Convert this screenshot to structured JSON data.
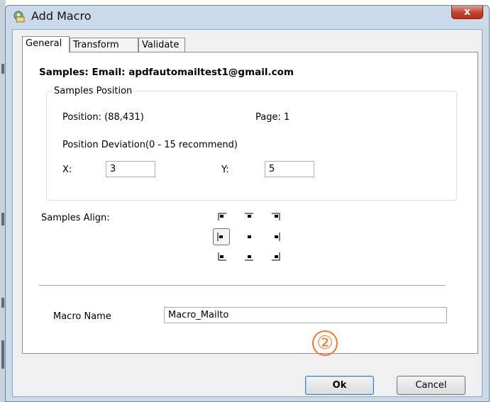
{
  "window": {
    "title": "Add Macro",
    "close_glyph": "x"
  },
  "tabs": [
    {
      "label": "General",
      "active": true
    },
    {
      "label": "Transform",
      "active": false
    },
    {
      "label": "Validate",
      "active": false
    }
  ],
  "general": {
    "samples_text": "Samples: Email: apdfautomailtest1@gmail.com",
    "samples_position": {
      "title": "Samples Position",
      "position_text": "Position: (88,431)",
      "page_text": "Page: 1",
      "deviation_label": "Position Deviation(0 - 15 recommend)",
      "x_label": "X:",
      "x_value": "3",
      "y_label": "Y:",
      "y_value": "5"
    },
    "samples_align": {
      "label": "Samples Align:",
      "selected": "middle-left"
    },
    "macro_name": {
      "label": "Macro Name",
      "value": "Macro_Mailto"
    }
  },
  "annotation": {
    "marker": "②",
    "color": "#f07a2a"
  },
  "buttons": {
    "ok": "Ok",
    "cancel": "Cancel"
  }
}
